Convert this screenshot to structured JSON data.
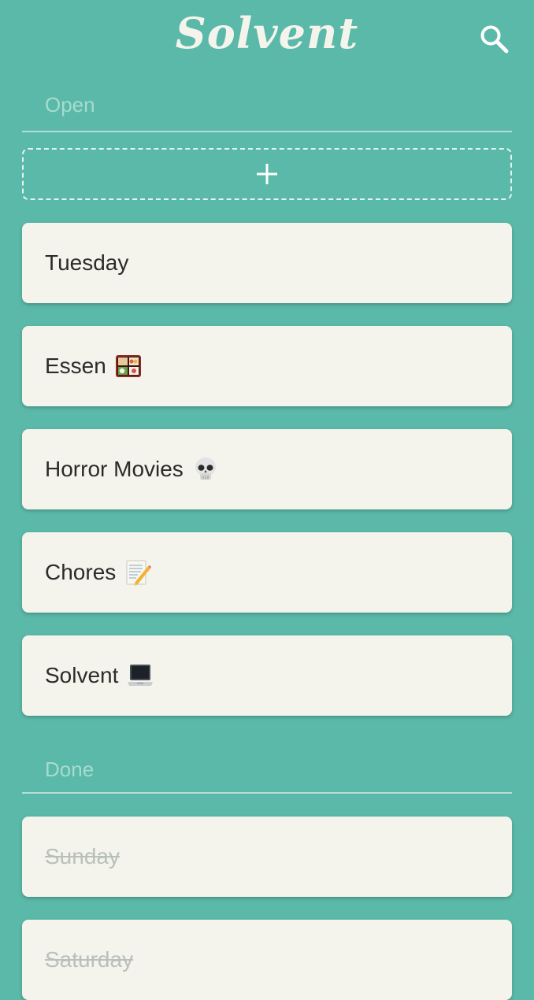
{
  "app": {
    "title": "Solvent",
    "accent_color": "#5ab9a8",
    "card_color": "#f4f4ec"
  },
  "header": {
    "search_icon": "search-icon"
  },
  "sections": {
    "open": {
      "title": "Open",
      "add_icon": "plus-icon",
      "items": [
        {
          "label": "Tuesday",
          "icon": ""
        },
        {
          "label": "Essen",
          "icon": "bento-box-emoji"
        },
        {
          "label": "Horror Movies",
          "icon": "skull-emoji"
        },
        {
          "label": "Chores",
          "icon": "memo-emoji"
        },
        {
          "label": "Solvent",
          "icon": "laptop-emoji"
        }
      ]
    },
    "done": {
      "title": "Done",
      "items": [
        {
          "label": "Sunday",
          "icon": ""
        },
        {
          "label": "Saturday",
          "icon": ""
        }
      ]
    }
  }
}
